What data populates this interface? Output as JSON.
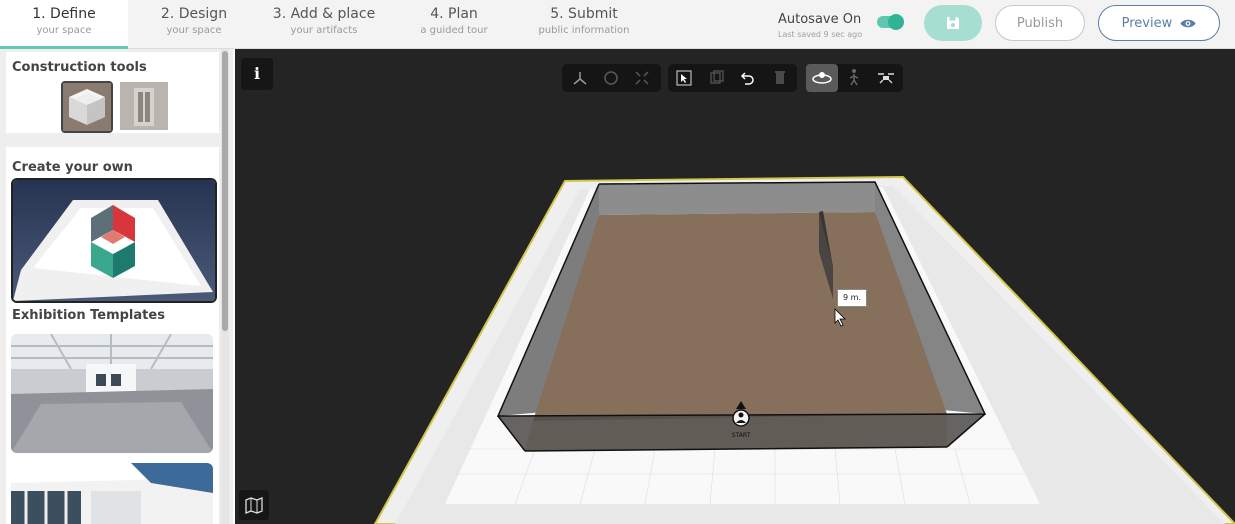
{
  "steps": [
    {
      "title": "1. Define",
      "sub": "your space",
      "active": true
    },
    {
      "title": "2. Design",
      "sub": "your space"
    },
    {
      "title": "3. Add & place",
      "sub": "your artifacts"
    },
    {
      "title": "4. Plan",
      "sub": "a guided tour"
    },
    {
      "title": "5. Submit",
      "sub": "public information"
    }
  ],
  "autosave": {
    "label": "Autosave On",
    "last_saved": "Last saved 9 sec ago",
    "enabled": true
  },
  "buttons": {
    "publish": "Publish",
    "preview": "Preview"
  },
  "sidebar": {
    "construction_title": "Construction tools",
    "tools": [
      "room-tool",
      "wall-tool"
    ],
    "create_title": "Create your own",
    "templates_title": "Exhibition Templates"
  },
  "viewport": {
    "info_label": "i",
    "dimension_label": "9 m.",
    "start_label": "START"
  },
  "colors": {
    "accent": "#64c8b4",
    "toggle": "#2fb595",
    "preview": "#5b7fa8",
    "save": "#a6ded1"
  }
}
